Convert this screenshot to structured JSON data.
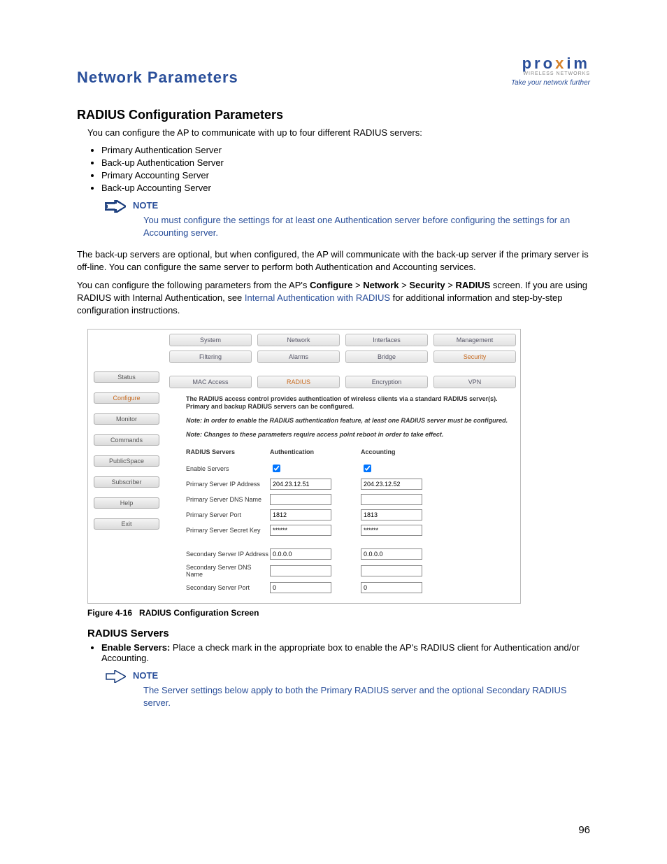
{
  "header": {
    "title": "Network Parameters",
    "logo_main_pre": "pro",
    "logo_main_x": "x",
    "logo_main_post": "im",
    "logo_sub1": "WIRELESS NETWORKS",
    "logo_sub2": "Take your network further"
  },
  "h2_radius_config": "RADIUS Configuration Parameters",
  "intro_para": "You can configure the AP to communicate with up to four different RADIUS servers:",
  "server_bullets": [
    "Primary Authentication Server",
    "Back-up Authentication Server",
    "Primary Accounting Server",
    "Back-up Accounting Server"
  ],
  "note1": {
    "heading": "NOTE",
    "text": "You must configure the settings for at least one Authentication server before configuring the settings for an Accounting server."
  },
  "para_backup": "The back-up servers are optional, but when configured, the AP will communicate with the back-up server if the primary server is off-line. You can configure the same server to perform both Authentication and Accounting services.",
  "para_config_pre": "You can configure the following parameters from the AP's ",
  "breadcrumb": {
    "a": "Configure",
    "b": "Network",
    "c": "Security",
    "d": "RADIUS"
  },
  "para_config_mid": " screen. If you are using RADIUS with Internal Authentication, see ",
  "para_config_link": "Internal Authentication with RADIUS",
  "para_config_post": " for additional information and step-by-step configuration instructions.",
  "screenshot": {
    "sidebar": [
      "Status",
      "Configure",
      "Monitor",
      "Commands",
      "PublicSpace",
      "Subscriber",
      "Help",
      "Exit"
    ],
    "sidebar_active": "Configure",
    "tabs_top": [
      "System",
      "Network",
      "Interfaces",
      "Management"
    ],
    "tabs_mid": [
      "Filtering",
      "Alarms",
      "Bridge",
      "Security"
    ],
    "tabs_mid_active": "Security",
    "tabs_sub": [
      "MAC Access",
      "RADIUS",
      "Encryption",
      "VPN"
    ],
    "tabs_sub_active": "RADIUS",
    "desc1": "The RADIUS access control provides authentication of wireless clients via a standard RADIUS server(s). Primary and backup RADIUS servers can be configured.",
    "desc2": "Note: In order to enable the RADIUS authentication feature, at least one RADIUS server must be configured.",
    "desc3": "Note: Changes to these parameters require access point reboot in order to take effect.",
    "col_labels": {
      "a": "RADIUS Servers",
      "b": "Authentication",
      "c": "Accounting"
    },
    "rows": {
      "enable": "Enable Servers",
      "pip": "Primary Server IP Address",
      "pdns": "Primary Server DNS Name",
      "pport": "Primary Server Port",
      "pkey": "Primary Server Secret Key",
      "sip": "Secondary Server IP Address",
      "sdns": "Secondary Server DNS Name",
      "sport": "Secondary Server Port"
    },
    "values": {
      "auth_ip": "204.23.12.51",
      "auth_dns": "",
      "auth_port": "1812",
      "auth_key": "******",
      "acct_ip": "204.23.12.52",
      "acct_dns": "",
      "acct_port": "1813",
      "acct_key": "******",
      "sec_auth_ip": "0.0.0.0",
      "sec_auth_dns": "",
      "sec_auth_port": "0",
      "sec_acct_ip": "0.0.0.0",
      "sec_acct_dns": "",
      "sec_acct_port": "0"
    }
  },
  "figure_caption": {
    "label": "Figure 4-16",
    "text": "RADIUS Configuration Screen"
  },
  "h3_radius_servers": "RADIUS Servers",
  "enable_servers_bold": "Enable Servers:",
  "enable_servers_text": " Place a check mark in the appropriate box to enable the AP's RADIUS client for Authentication and/or Accounting.",
  "note2": {
    "heading": "NOTE",
    "text": "The Server settings below apply to both the Primary RADIUS server and the optional Secondary RADIUS server."
  },
  "page_number": "96"
}
